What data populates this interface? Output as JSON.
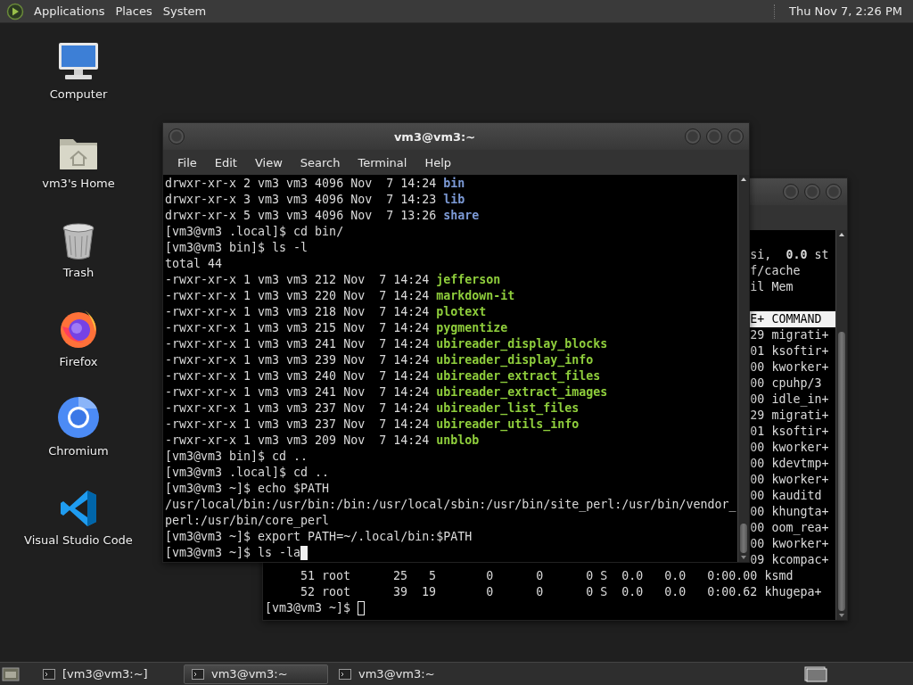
{
  "top_panel": {
    "menus": [
      "Applications",
      "Places",
      "System"
    ],
    "clock": "Thu Nov 7, 2:26 PM"
  },
  "desktop_icons": [
    {
      "label": "Computer",
      "kind": "computer"
    },
    {
      "label": "vm3's Home",
      "kind": "home"
    },
    {
      "label": "Trash",
      "kind": "trash"
    },
    {
      "label": "Firefox",
      "kind": "firefox"
    },
    {
      "label": "Chromium",
      "kind": "chromium"
    },
    {
      "label": "Visual Studio Code",
      "kind": "vscode"
    }
  ],
  "terminals": [
    {
      "title": "vm3@vm3:~",
      "focused": true,
      "menu": [
        "File",
        "Edit",
        "View",
        "Search",
        "Terminal",
        "Help"
      ],
      "lines": [
        {
          "kind": "directory",
          "text": "drwxr-xr-x 2 vm3 vm3 4096 Nov  7 14:24 ",
          "name": "bin"
        },
        {
          "kind": "directory",
          "text": "drwxr-xr-x 3 vm3 vm3 4096 Nov  7 14:23 ",
          "name": "lib"
        },
        {
          "kind": "directory",
          "text": "drwxr-xr-x 5 vm3 vm3 4096 Nov  7 13:26 ",
          "name": "share"
        },
        {
          "kind": "plain",
          "text": "[vm3@vm3 .local]$ cd bin/"
        },
        {
          "kind": "plain",
          "text": "[vm3@vm3 bin]$ ls -l"
        },
        {
          "kind": "plain",
          "text": "total 44"
        },
        {
          "kind": "executable",
          "text": "-rwxr-xr-x 1 vm3 vm3 212 Nov  7 14:24 ",
          "name": "jefferson"
        },
        {
          "kind": "executable",
          "text": "-rwxr-xr-x 1 vm3 vm3 220 Nov  7 14:24 ",
          "name": "markdown-it"
        },
        {
          "kind": "executable",
          "text": "-rwxr-xr-x 1 vm3 vm3 218 Nov  7 14:24 ",
          "name": "plotext"
        },
        {
          "kind": "executable",
          "text": "-rwxr-xr-x 1 vm3 vm3 215 Nov  7 14:24 ",
          "name": "pygmentize"
        },
        {
          "kind": "executable",
          "text": "-rwxr-xr-x 1 vm3 vm3 241 Nov  7 14:24 ",
          "name": "ubireader_display_blocks"
        },
        {
          "kind": "executable",
          "text": "-rwxr-xr-x 1 vm3 vm3 239 Nov  7 14:24 ",
          "name": "ubireader_display_info"
        },
        {
          "kind": "executable",
          "text": "-rwxr-xr-x 1 vm3 vm3 240 Nov  7 14:24 ",
          "name": "ubireader_extract_files"
        },
        {
          "kind": "executable",
          "text": "-rwxr-xr-x 1 vm3 vm3 241 Nov  7 14:24 ",
          "name": "ubireader_extract_images"
        },
        {
          "kind": "executable",
          "text": "-rwxr-xr-x 1 vm3 vm3 237 Nov  7 14:24 ",
          "name": "ubireader_list_files"
        },
        {
          "kind": "executable",
          "text": "-rwxr-xr-x 1 vm3 vm3 237 Nov  7 14:24 ",
          "name": "ubireader_utils_info"
        },
        {
          "kind": "executable",
          "text": "-rwxr-xr-x 1 vm3 vm3 209 Nov  7 14:24 ",
          "name": "unblob"
        },
        {
          "kind": "plain",
          "text": "[vm3@vm3 bin]$ cd .."
        },
        {
          "kind": "plain",
          "text": "[vm3@vm3 .local]$ cd .."
        },
        {
          "kind": "plain",
          "text": "[vm3@vm3 ~]$ echo $PATH"
        },
        {
          "kind": "plain",
          "text": "/usr/local/bin:/usr/bin:/bin:/usr/local/sbin:/usr/bin/site_perl:/usr/bin/vendor_"
        },
        {
          "kind": "plain",
          "text": "perl:/usr/bin/core_perl"
        },
        {
          "kind": "plain",
          "text": "[vm3@vm3 ~]$ export PATH=~/.local/bin:$PATH"
        },
        {
          "kind": "input",
          "text": "[vm3@vm3 ~]$ ls -la"
        }
      ]
    },
    {
      "focused": false,
      "lines": [
        {
          "kind": "fragment",
          "text": "si,  **0.0** st"
        },
        {
          "kind": "fragment",
          "text": "f/cache"
        },
        {
          "kind": "fragment",
          "text": "il Mem"
        },
        {
          "kind": "header",
          "text": "E+ COMMAND"
        },
        {
          "kind": "fragment",
          "text": "29 migrati+"
        },
        {
          "kind": "fragment",
          "text": "01 ksoftir+"
        },
        {
          "kind": "fragment",
          "text": "00 kworker+"
        },
        {
          "kind": "fragment",
          "text": "00 cpuhp/3"
        },
        {
          "kind": "fragment",
          "text": "00 idle_in+"
        },
        {
          "kind": "fragment",
          "text": "29 migrati+"
        },
        {
          "kind": "fragment",
          "text": "01 ksoftir+"
        },
        {
          "kind": "fragment",
          "text": "00 kworker+"
        },
        {
          "kind": "fragment",
          "text": "00 kdevtmp+"
        },
        {
          "kind": "fragment",
          "text": "00 kworker+"
        },
        {
          "kind": "fragment",
          "text": "00 kauditd"
        },
        {
          "kind": "fragment",
          "text": "00 khungta+"
        },
        {
          "kind": "fragment",
          "text": "00 oom_rea+"
        },
        {
          "kind": "fragment",
          "text": "00 kworker+"
        },
        {
          "kind": "fragment",
          "text": "09 kcompac+"
        },
        {
          "kind": "plain",
          "text": "     51 root      25   5       0      0      0 S  0.0   0.0   0:00.00 ksmd"
        },
        {
          "kind": "plain",
          "text": "     52 root      39  19       0      0      0 S  0.0   0.0   0:00.62 khugepa+"
        },
        {
          "kind": "input",
          "text": "[vm3@vm3 ~]$ "
        }
      ]
    }
  ],
  "taskbar": {
    "items": [
      {
        "label": "[vm3@vm3:~]",
        "selected": false
      },
      {
        "label": "vm3@vm3:~",
        "selected": true
      },
      {
        "label": "vm3@vm3:~",
        "selected": false
      }
    ]
  }
}
